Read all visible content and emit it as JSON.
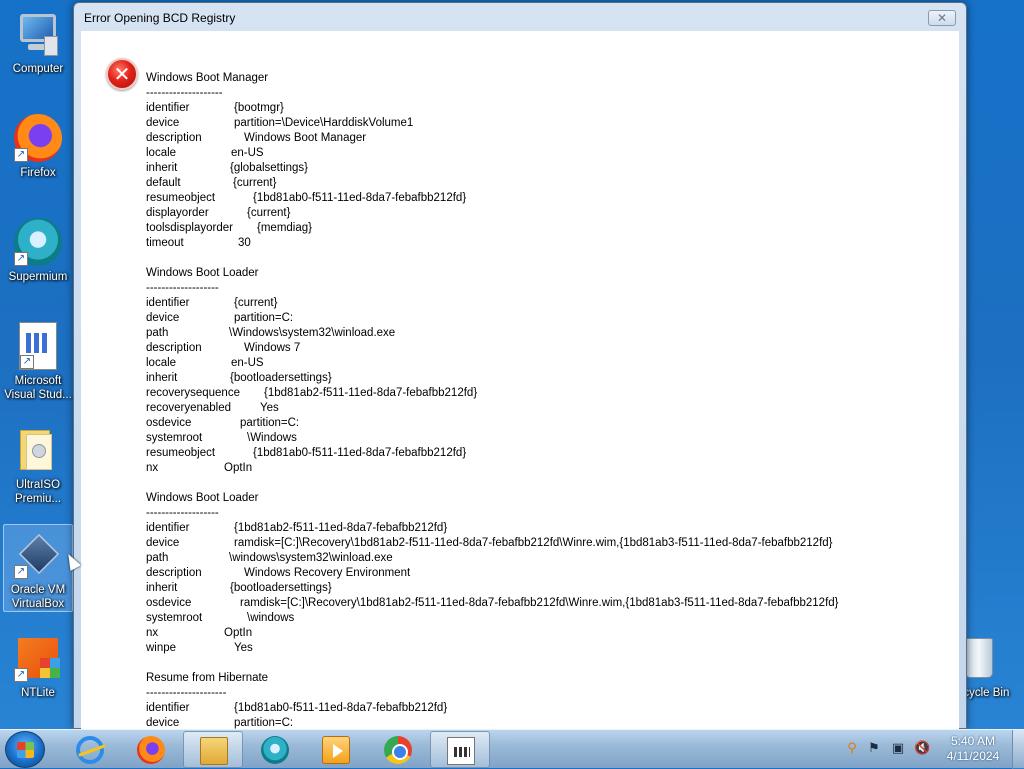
{
  "desktop": {
    "icons": [
      {
        "label": "Computer",
        "icon": "computer-icon"
      },
      {
        "label": "Firefox",
        "icon": "firefox-icon"
      },
      {
        "label": "Supermium",
        "icon": "supermium-icon"
      },
      {
        "label": "Microsoft Visual Stud...",
        "icon": "visual-studio-doc-icon"
      },
      {
        "label": "UltraISO Premiu...",
        "icon": "ultraiso-icon"
      },
      {
        "label": "Oracle VM VirtualBox",
        "icon": "virtualbox-icon"
      },
      {
        "label": "NTLite",
        "icon": "ntlite-icon"
      },
      {
        "label": "Recycle Bin",
        "icon": "recycle-bin-icon"
      }
    ]
  },
  "dialog": {
    "title": "Error Opening BCD Registry",
    "close_label": "✕",
    "lines": [
      {
        "k": "Windows Boot Manager",
        "v": ""
      },
      {
        "k": "--------------------",
        "v": ""
      },
      {
        "k": "identifier",
        "v": "{bootmgr}"
      },
      {
        "k": "device",
        "v": "partition=\\Device\\HarddiskVolume1"
      },
      {
        "k": "description",
        "v": "Windows Boot Manager"
      },
      {
        "k": "locale",
        "v": "en-US"
      },
      {
        "k": "inherit",
        "v": "{globalsettings}"
      },
      {
        "k": "default",
        "v": "{current}"
      },
      {
        "k": "resumeobject",
        "v": "{1bd81ab0-f511-11ed-8da7-febafbb212fd}"
      },
      {
        "k": "displayorder",
        "v": "{current}"
      },
      {
        "k": "toolsdisplayorder",
        "v": "{memdiag}"
      },
      {
        "k": "timeout",
        "v": "30"
      },
      {
        "k": "",
        "v": ""
      },
      {
        "k": "Windows Boot Loader",
        "v": ""
      },
      {
        "k": "-------------------",
        "v": ""
      },
      {
        "k": "identifier",
        "v": "{current}"
      },
      {
        "k": "device",
        "v": "partition=C:"
      },
      {
        "k": "path",
        "v": "\\Windows\\system32\\winload.exe"
      },
      {
        "k": "description",
        "v": "Windows 7"
      },
      {
        "k": "locale",
        "v": "en-US"
      },
      {
        "k": "inherit",
        "v": "{bootloadersettings}"
      },
      {
        "k": "recoverysequence",
        "v": "{1bd81ab2-f511-11ed-8da7-febafbb212fd}"
      },
      {
        "k": "recoveryenabled",
        "v": "Yes"
      },
      {
        "k": "osdevice",
        "v": "partition=C:"
      },
      {
        "k": "systemroot",
        "v": "\\Windows"
      },
      {
        "k": "resumeobject",
        "v": "{1bd81ab0-f511-11ed-8da7-febafbb212fd}"
      },
      {
        "k": "nx",
        "v": "OptIn"
      },
      {
        "k": "",
        "v": ""
      },
      {
        "k": "Windows Boot Loader",
        "v": ""
      },
      {
        "k": "-------------------",
        "v": ""
      },
      {
        "k": "identifier",
        "v": "{1bd81ab2-f511-11ed-8da7-febafbb212fd}"
      },
      {
        "k": "device",
        "v": "ramdisk=[C:]\\Recovery\\1bd81ab2-f511-11ed-8da7-febafbb212fd\\Winre.wim,{1bd81ab3-f511-11ed-8da7-febafbb212fd}"
      },
      {
        "k": "path",
        "v": "\\windows\\system32\\winload.exe"
      },
      {
        "k": "description",
        "v": "Windows Recovery Environment"
      },
      {
        "k": "inherit",
        "v": "{bootloadersettings}"
      },
      {
        "k": "osdevice",
        "v": "ramdisk=[C:]\\Recovery\\1bd81ab2-f511-11ed-8da7-febafbb212fd\\Winre.wim,{1bd81ab3-f511-11ed-8da7-febafbb212fd}"
      },
      {
        "k": "systemroot",
        "v": "\\windows"
      },
      {
        "k": "nx",
        "v": "OptIn"
      },
      {
        "k": "winpe",
        "v": "Yes"
      },
      {
        "k": "",
        "v": ""
      },
      {
        "k": "Resume from Hibernate",
        "v": ""
      },
      {
        "k": "---------------------",
        "v": ""
      },
      {
        "k": "identifier",
        "v": "{1bd81ab0-f511-11ed-8da7-febafbb212fd}"
      },
      {
        "k": "device",
        "v": "partition=C:"
      }
    ]
  },
  "taskbar": {
    "buttons": [
      "start-button",
      "internet-explorer",
      "firefox",
      "windows-explorer",
      "supermium",
      "media-player",
      "chrome",
      "bcd-editor"
    ],
    "clock": {
      "time": "5:40 AM",
      "date": "4/11/2024"
    }
  },
  "colors": {
    "desktop_bg": "#1c6fc1",
    "error_red": "#e0241a"
  }
}
